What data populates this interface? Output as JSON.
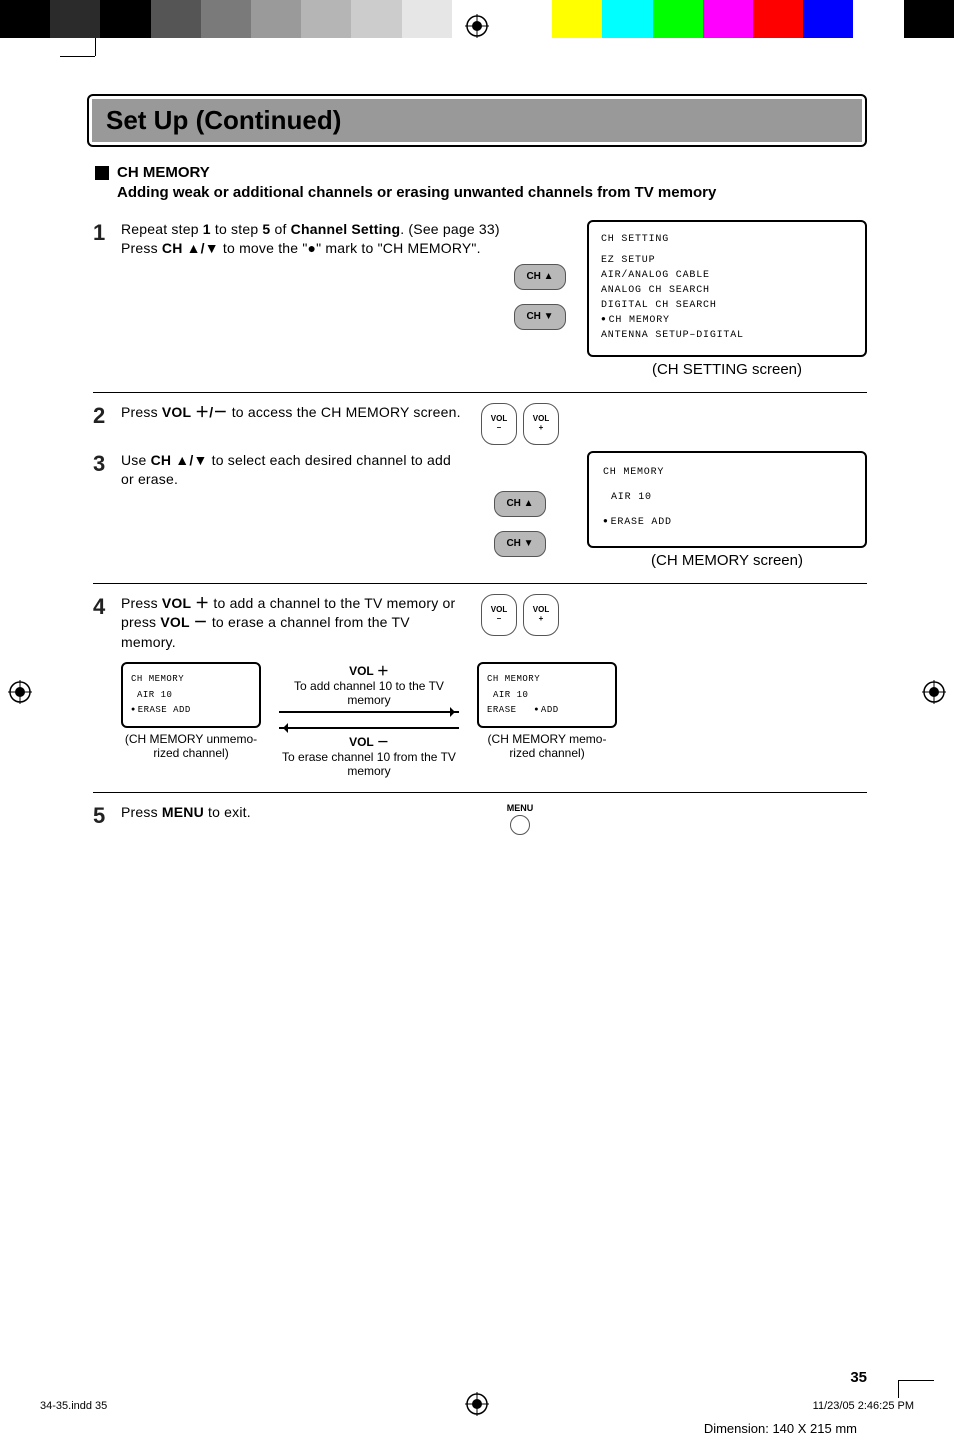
{
  "colorbar": [
    "#000000",
    "#2b2b2b",
    "#000000",
    "#555555",
    "#7a7a7a",
    "#9a9a9a",
    "#b5b5b5",
    "#cccccc",
    "#e6e6e6",
    "#ffffff",
    "#ffffff",
    "#ffff00",
    "#00ffff",
    "#00ff00",
    "#ff00ff",
    "#ff0000",
    "#0000ff",
    "#ffffff",
    "#000000"
  ],
  "title": "Set Up (Continued)",
  "section": {
    "heading": "CH MEMORY",
    "sub": "Adding weak or additional channels or erasing unwanted channels from TV memory"
  },
  "steps": {
    "s1": {
      "num": "1",
      "text_a": "Repeat step ",
      "bold_a": "1",
      "text_b": " to step ",
      "bold_b": "5",
      "text_c": " of ",
      "bold_c": "Channel Setting",
      "text_d": ". (See page 33)",
      "line2_a": "Press ",
      "line2_bold": "CH ▲/▼",
      "line2_b": " to move the \"●\" mark to \"CH MEMORY\".",
      "btn_up": "CH ▲",
      "btn_down": "CH ▼",
      "osd": {
        "title": "CH SETTING",
        "items": [
          "EZ SETUP",
          "AIR/ANALOG CABLE",
          "ANALOG CH SEARCH",
          "DIGITAL CH SEARCH",
          "CH MEMORY",
          "ANTENNA SETUP–DIGITAL"
        ],
        "caption": "(CH SETTING screen)"
      }
    },
    "s2": {
      "num": "2",
      "text_a": "Press ",
      "bold_a": "VOL ＋/－",
      "text_b": " to access the CH MEMORY screen.",
      "vol_minus_l1": "VOL",
      "vol_minus_l2": "–",
      "vol_plus_l1": "VOL",
      "vol_plus_l2": "+"
    },
    "s3": {
      "num": "3",
      "text_a": "Use ",
      "bold_a": "CH ▲/▼",
      "text_b": " to select each desired channel to add or erase.",
      "btn_up": "CH ▲",
      "btn_down": "CH ▼",
      "osd": {
        "title": "CH MEMORY",
        "line": "AIR 10",
        "opts": "ERASE   ADD",
        "caption": "(CH MEMORY screen)"
      }
    },
    "s4": {
      "num": "4",
      "text_a": "Press ",
      "bold_a": "VOL ＋",
      "text_b": " to add a channel to the TV memory or press ",
      "bold_b": "VOL －",
      "text_c": " to erase a channel from the TV memory.",
      "vol_minus_l1": "VOL",
      "vol_minus_l2": "–",
      "vol_plus_l1": "VOL",
      "vol_plus_l2": "+",
      "left_osd": {
        "title": "CH MEMORY",
        "line": "AIR 10",
        "opts": "ERASE   ADD",
        "caption": "(CH MEMORY unmemo-rized channel)"
      },
      "center": {
        "up_lbl": "VOL ＋",
        "up_txt": "To add channel 10 to the TV memory",
        "dn_lbl": "VOL －",
        "dn_txt": "To erase channel 10 from the TV memory"
      },
      "right_osd": {
        "title": "CH MEMORY",
        "line": "AIR 10",
        "opts": "ERASE   ADD",
        "caption": "(CH MEMORY memo-rized channel)"
      }
    },
    "s5": {
      "num": "5",
      "text_a": "Press ",
      "bold_a": "MENU",
      "text_b": " to exit.",
      "menu_label": "MENU"
    }
  },
  "page_number": "35",
  "dimension": "Dimension: 140  X 215 mm",
  "footer_left": "34-35.indd   35",
  "footer_right": "11/23/05   2:46:25 PM"
}
